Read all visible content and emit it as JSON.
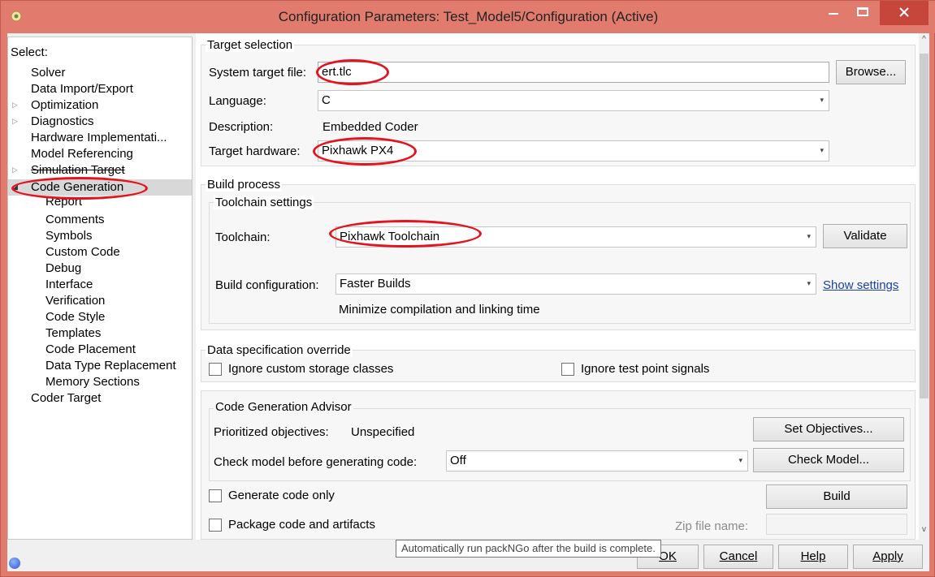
{
  "window": {
    "title": "Configuration Parameters: Test_Model5/Configuration (Active)"
  },
  "tree": {
    "select_label": "Select:",
    "items": [
      "Solver",
      "Data Import/Export",
      "Optimization",
      "Diagnostics",
      "Hardware Implementati...",
      "Model Referencing",
      "Simulation Target",
      "Code Generation",
      "Report",
      "Comments",
      "Symbols",
      "Custom Code",
      "Debug",
      "Interface",
      "Verification",
      "Code Style",
      "Templates",
      "Code Placement",
      "Data Type Replacement",
      "Memory Sections",
      "Coder Target"
    ]
  },
  "target_selection": {
    "title": "Target selection",
    "system_target_file_label": "System target file:",
    "system_target_file_value": "ert.tlc",
    "browse_button": "Browse...",
    "language_label": "Language:",
    "language_value": "C",
    "description_label": "Description:",
    "description_value": "Embedded Coder",
    "target_hardware_label": "Target hardware:",
    "target_hardware_value": "Pixhawk PX4"
  },
  "build_process": {
    "title": "Build process",
    "toolchain_settings_title": "Toolchain settings",
    "toolchain_label": "Toolchain:",
    "toolchain_value": "Pixhawk Toolchain",
    "validate_button": "Validate",
    "build_config_label": "Build configuration:",
    "build_config_value": "Faster Builds",
    "show_settings_link": "Show settings",
    "build_config_hint": "Minimize compilation and linking time"
  },
  "data_spec_override": {
    "title": "Data specification override",
    "ignore_storage_label": "Ignore custom storage classes",
    "ignore_test_label": "Ignore test point signals"
  },
  "advisor": {
    "title": "Code Generation Advisor",
    "prioritized_label": "Prioritized objectives:",
    "prioritized_value": "Unspecified",
    "set_objectives_button": "Set Objectives...",
    "check_model_label": "Check model before generating code:",
    "check_model_value": "Off",
    "check_model_button": "Check Model..."
  },
  "generate": {
    "generate_only_label": "Generate code only",
    "build_button": "Build",
    "package_label": "Package code and artifacts",
    "zip_label": "Zip file name:"
  },
  "tooltip": "Automatically run packNGo after the build is complete.",
  "footer": {
    "ok_button": "OK",
    "cancel_button": "Cancel",
    "help_button": "Help",
    "apply_button": "Apply"
  }
}
